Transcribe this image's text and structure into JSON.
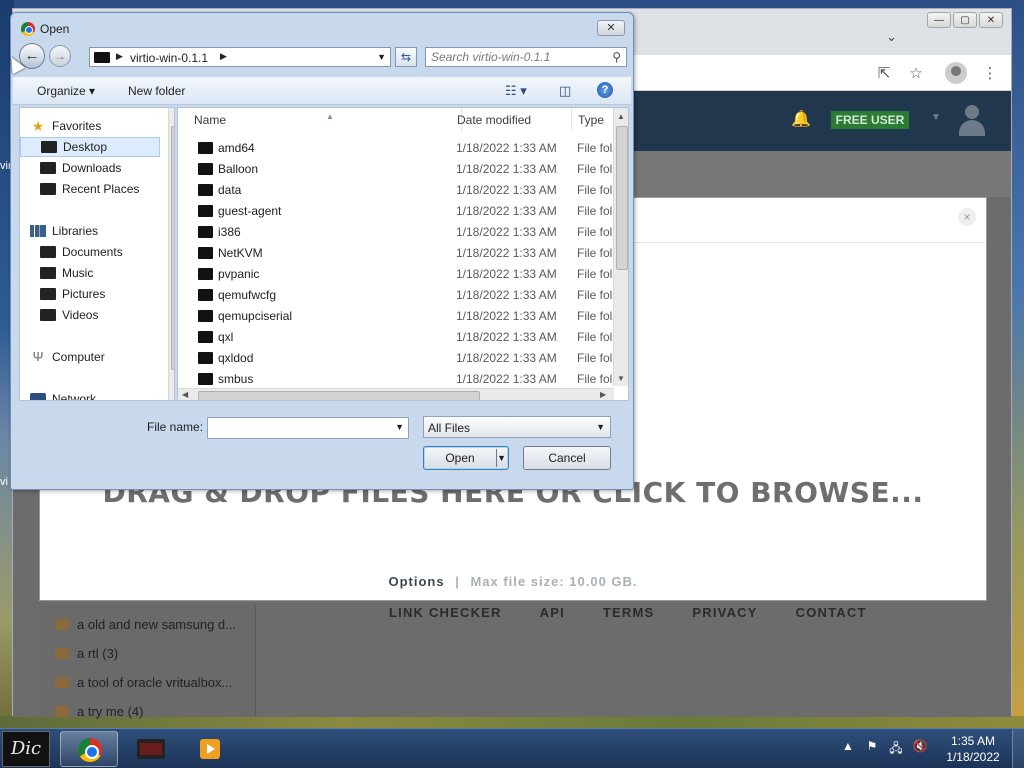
{
  "desktop": {
    "side_label_1": "vir",
    "side_label_2": "vi"
  },
  "browser": {
    "window_buttons": {
      "minimize": "—",
      "maximize": "▢",
      "close": "✕"
    },
    "tab_list_icon": "chevron-down-icon",
    "toolbar": {
      "share_icon": "⇱",
      "bookmark_icon": "☆",
      "menu_icon": "⋮"
    },
    "site": {
      "badge": "FREE USER",
      "nav": [
        "LINK CHECKER",
        "API",
        "TERMS",
        "PRIVACY",
        "CONTACT"
      ],
      "folders": [
        {
          "label": "a old and new samsung d..."
        },
        {
          "label": "a rtl (3)"
        },
        {
          "label": "a tool of oracle vritualbox..."
        },
        {
          "label": "a try me (4)"
        }
      ],
      "modal": {
        "close": "×",
        "dropzone": "DRAG & DROP FILES HERE OR CLICK TO BROWSE...",
        "options": "Options",
        "separator": "|",
        "max_size": "Max file size: 10.00 GB."
      }
    }
  },
  "dialog": {
    "title": "Open",
    "close": "✕",
    "back": "←",
    "forward": "→",
    "address": {
      "crumb": "virtio-win-0.1.1",
      "sep": "▶"
    },
    "search_placeholder": "Search virtio-win-0.1.1",
    "commands": {
      "organize": "Organize ▾",
      "new_folder": "New folder",
      "views": "☷ ▾",
      "preview": "◫",
      "help": "?"
    },
    "nav_pane": [
      {
        "label": "Favorites",
        "icon": "star-icon",
        "type": "header"
      },
      {
        "label": "Desktop",
        "icon": "desktop-icon",
        "type": "item",
        "selected": true
      },
      {
        "label": "Downloads",
        "icon": "downloads-icon",
        "type": "item"
      },
      {
        "label": "Recent Places",
        "icon": "recent-places-icon",
        "type": "item"
      },
      {
        "label": "Libraries",
        "icon": "libraries-icon",
        "type": "header"
      },
      {
        "label": "Documents",
        "icon": "documents-icon",
        "type": "item"
      },
      {
        "label": "Music",
        "icon": "music-icon",
        "type": "item"
      },
      {
        "label": "Pictures",
        "icon": "pictures-icon",
        "type": "item"
      },
      {
        "label": "Videos",
        "icon": "videos-icon",
        "type": "item"
      },
      {
        "label": "Computer",
        "icon": "computer-icon",
        "type": "header"
      },
      {
        "label": "Network",
        "icon": "network-icon",
        "type": "header"
      }
    ],
    "columns": {
      "name": "Name",
      "date": "Date modified",
      "type": "Type"
    },
    "files": [
      {
        "name": "amd64",
        "date": "1/18/2022 1:33 AM",
        "type": "File fol"
      },
      {
        "name": "Balloon",
        "date": "1/18/2022 1:33 AM",
        "type": "File fol"
      },
      {
        "name": "data",
        "date": "1/18/2022 1:33 AM",
        "type": "File fol"
      },
      {
        "name": "guest-agent",
        "date": "1/18/2022 1:33 AM",
        "type": "File fol"
      },
      {
        "name": "i386",
        "date": "1/18/2022 1:33 AM",
        "type": "File fol"
      },
      {
        "name": "NetKVM",
        "date": "1/18/2022 1:33 AM",
        "type": "File fol"
      },
      {
        "name": "pvpanic",
        "date": "1/18/2022 1:33 AM",
        "type": "File fol"
      },
      {
        "name": "qemufwcfg",
        "date": "1/18/2022 1:33 AM",
        "type": "File fol"
      },
      {
        "name": "qemupciserial",
        "date": "1/18/2022 1:33 AM",
        "type": "File fol"
      },
      {
        "name": "qxl",
        "date": "1/18/2022 1:33 AM",
        "type": "File fol"
      },
      {
        "name": "qxldod",
        "date": "1/18/2022 1:33 AM",
        "type": "File fol"
      },
      {
        "name": "smbus",
        "date": "1/18/2022 1:33 AM",
        "type": "File fol"
      }
    ],
    "file_name_label": "File name:",
    "file_name_value": "",
    "filter_value": "All Files",
    "open_button": "Open",
    "cancel_button": "Cancel"
  },
  "taskbar": {
    "start_label": "Dic",
    "tray_icons": {
      "show_hidden": "▲",
      "flag": "⚑",
      "network": "🖧",
      "volume": "🔇"
    },
    "time": "1:35 AM",
    "date": "1/18/2022"
  }
}
